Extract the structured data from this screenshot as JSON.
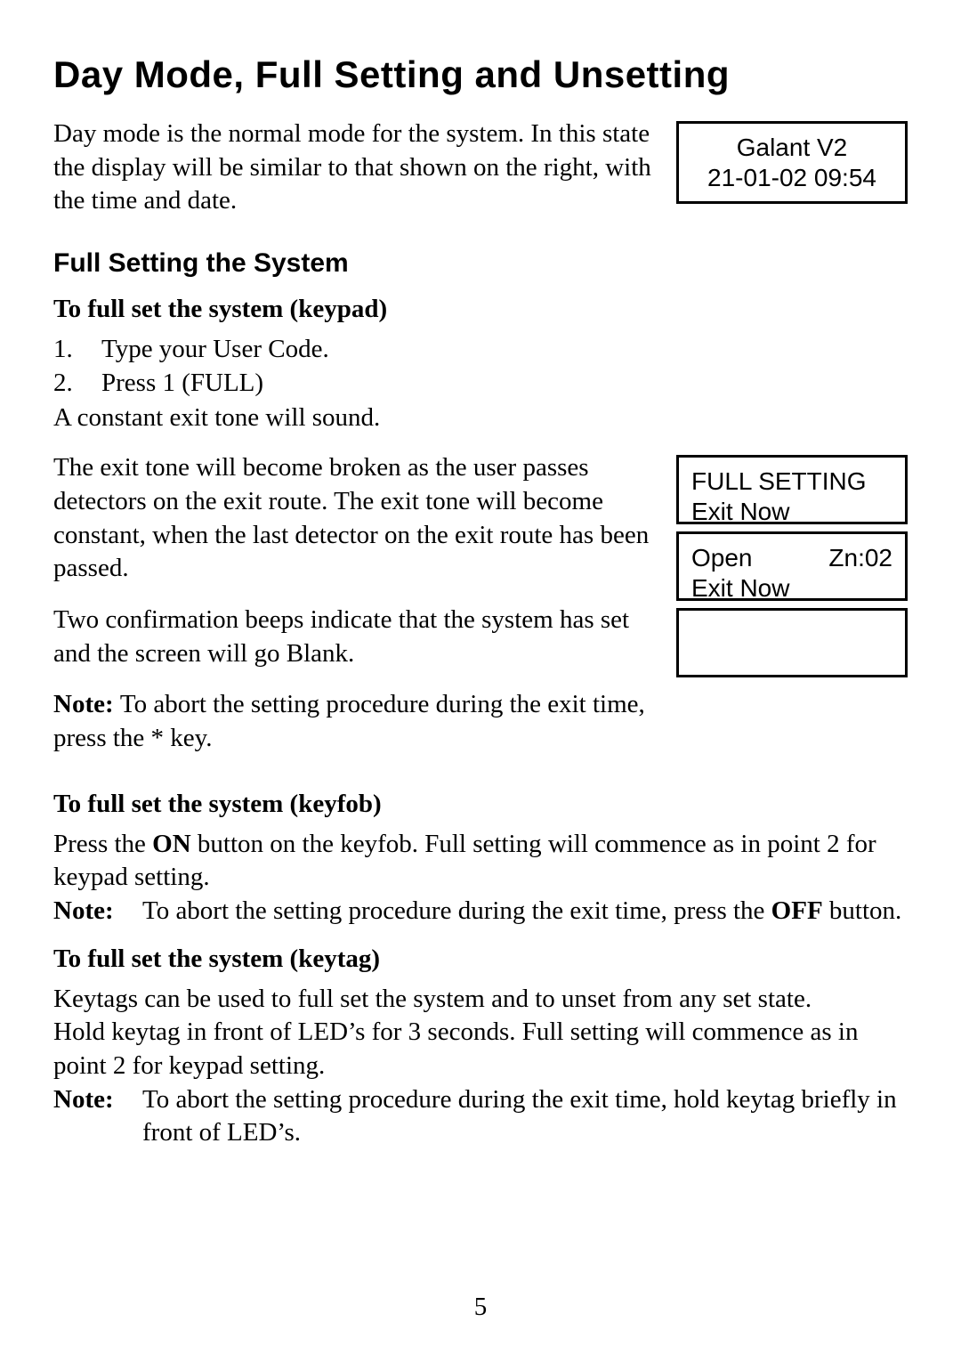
{
  "title": "Day Mode, Full Setting and Unsetting",
  "intro": "Day mode is the normal mode for the system. In this state the display will be similar to that shown on the right, with the time and date.",
  "lcd_top": {
    "line1": "Galant V2",
    "line2": "21-01-02  09:54"
  },
  "h2_fullset": "Full Setting the System",
  "h3_keypad": "To full set the system (keypad)",
  "steps_keypad": [
    {
      "n": "1.",
      "t": "Type your User Code."
    },
    {
      "n": "2.",
      "t": "Press 1 (FULL)"
    }
  ],
  "after_steps": "A constant exit tone will sound.",
  "para_exit": "The exit tone will become broken as the user passes detectors on the exit route. The exit tone will become constant, when the last detector on the exit route has been passed.",
  "para_beeps": "Two confirmation beeps indicate that the system has set and the screen will go Blank.",
  "note1_label": "Note: ",
  "note1_text": "To abort the setting procedure during the exit time, press the * key.",
  "lcds": {
    "a": {
      "l1": "FULL SETTING",
      "l2": "Exit Now"
    },
    "b": {
      "l1a": "Open",
      "l1b": "Zn:02",
      "l2": "Exit Now"
    },
    "c": {
      "l1": "",
      "l2": ""
    }
  },
  "h3_keyfob": "To full set the system (keyfob)",
  "keyfob_p_pre": "Press the ",
  "keyfob_p_on": "ON",
  "keyfob_p_post": " button on the keyfob. Full setting will commence as in point 2 for keypad setting.",
  "keyfob_note_label": "Note:",
  "keyfob_note_pre": "To abort the setting procedure during the exit time, press the ",
  "keyfob_note_off": "OFF",
  "keyfob_note_post": " button.",
  "h3_keytag": "To full set the system  (keytag)",
  "keytag_p1": "Keytags can be used to full set the system and to unset from any set state.",
  "keytag_p2": "Hold keytag in front of LED’s for 3 seconds. Full setting will commence as in point 2 for keypad setting.",
  "keytag_note_label": "Note:",
  "keytag_note_text": "To abort the setting procedure during the exit time, hold keytag briefly in front of LED’s.",
  "page_number": "5"
}
